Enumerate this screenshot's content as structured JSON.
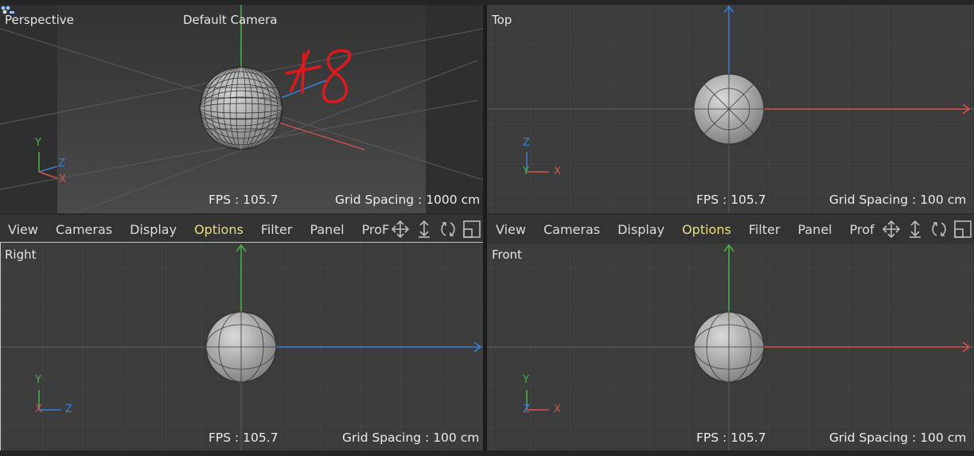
{
  "viewports": {
    "perspective": {
      "label": "Perspective",
      "camera": "Default Camera",
      "fps": "FPS : 105.7",
      "grid_spacing": "Grid Spacing : 1000 cm",
      "axes": {
        "y": "Y",
        "z": "Z",
        "x": "X"
      }
    },
    "top": {
      "label": "Top",
      "fps": "FPS : 105.7",
      "grid_spacing": "Grid Spacing : 100 cm",
      "axes": {
        "z": "Z",
        "y": "Y",
        "x": "X"
      }
    },
    "right": {
      "label": "Right",
      "fps": "FPS : 105.7",
      "grid_spacing": "Grid Spacing : 100 cm",
      "axes": {
        "y": "Y",
        "x": "X",
        "z": "Z"
      }
    },
    "front": {
      "label": "Front",
      "fps": "FPS : 105.7",
      "grid_spacing": "Grid Spacing : 100 cm",
      "axes": {
        "y": "Y",
        "z": "Z",
        "x": "X"
      }
    }
  },
  "menubar_left": {
    "items": [
      "View",
      "Cameras",
      "Display",
      "Options",
      "Filter",
      "Panel",
      "ProF"
    ],
    "active": "Options"
  },
  "menubar_right": {
    "items": [
      "View",
      "Cameras",
      "Display",
      "Options",
      "Filter",
      "Panel",
      "Prof"
    ],
    "active": "Options"
  },
  "nav_icons": [
    "move-view-icon",
    "zoom-view-icon",
    "rotate-view-icon",
    "maximize-view-icon"
  ],
  "annotation": "48",
  "colors": {
    "viewport_bg": "#3c3c3c",
    "grid_line": "#4a4a4a",
    "axis_x": "#d9534f",
    "axis_y": "#48b548",
    "axis_z": "#3a7fd6",
    "menu_active": "#e9e07a"
  }
}
